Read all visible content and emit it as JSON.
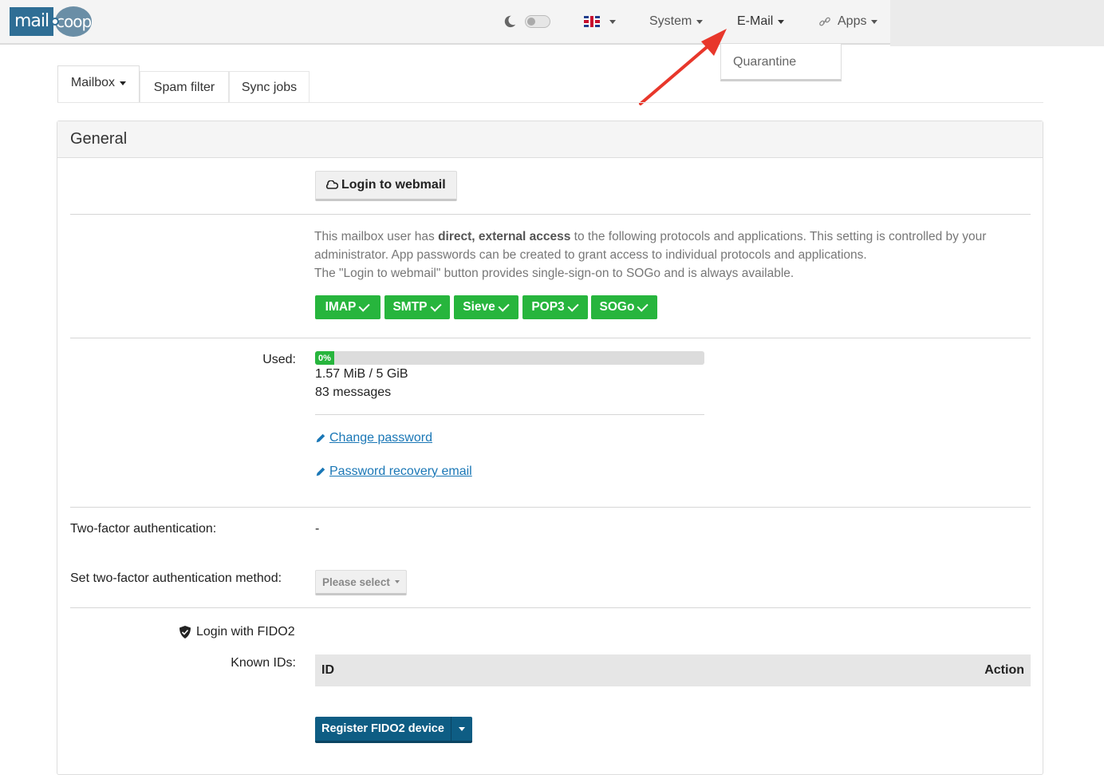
{
  "navbar": {
    "logo_left": "mail",
    "logo_right": "coop",
    "language_flag": "uk-flag-icon",
    "items": [
      {
        "label": "System"
      },
      {
        "label": "E-Mail"
      },
      {
        "label": "Apps"
      }
    ],
    "dropdown": {
      "items": [
        {
          "label": "Quarantine"
        }
      ]
    }
  },
  "tabs": [
    {
      "label": "Mailbox"
    },
    {
      "label": "Spam filter"
    },
    {
      "label": "Sync jobs"
    }
  ],
  "panel": {
    "title": "General",
    "webmail_button": "Login to webmail",
    "access_text": {
      "part1": "This mailbox user has ",
      "bold": "direct, external access",
      "part2": " to the following protocols and applications. This setting is controlled by your administrator. App passwords can be created to grant access to individual protocols and applications.",
      "line3": "The \"Login to webmail\" button provides single-sign-on to SOGo and is always available."
    },
    "protocols": [
      "IMAP",
      "SMTP",
      "Sieve",
      "POP3",
      "SOGo"
    ],
    "used_label": "Used:",
    "usage_percent_label": "0%",
    "usage_percent": 0,
    "usage_size": "1.57 MiB / 5 GiB",
    "usage_messages": "83 messages",
    "change_password": "Change password",
    "password_recovery": "Password recovery email",
    "tfa_label": "Two-factor authentication:",
    "tfa_value": "-",
    "tfa_method_label": "Set two-factor authentication method:",
    "tfa_method_select": "Please select",
    "fido_label": "Login with FIDO2",
    "known_ids_label": "Known IDs:",
    "table_headers": {
      "id": "ID",
      "action": "Action"
    },
    "register_button": "Register FIDO2 device"
  },
  "colors": {
    "success": "#27b53d",
    "primary": "#0e5d84",
    "link": "#1a77b6",
    "annotation_arrow": "#e8372b"
  }
}
